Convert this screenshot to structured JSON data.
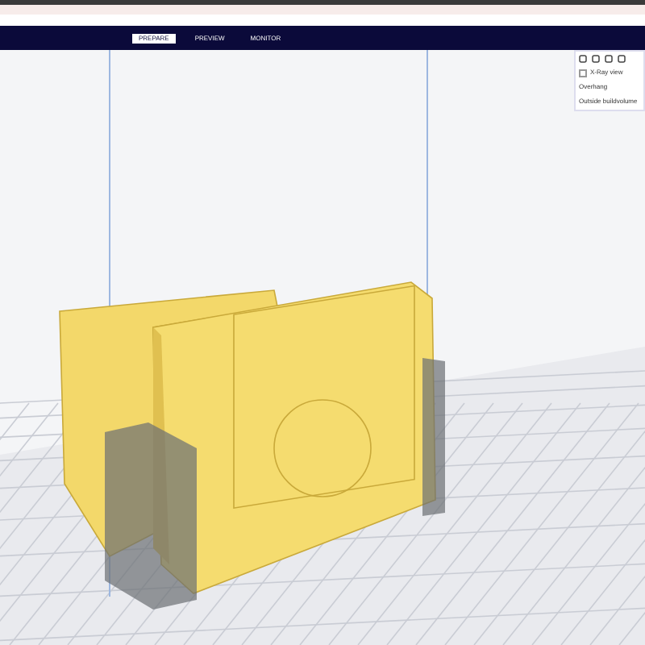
{
  "tabs": [
    {
      "label": "PREPARE",
      "selected": true
    },
    {
      "label": "PREVIEW",
      "selected": false
    },
    {
      "label": "MONITOR",
      "selected": false
    }
  ],
  "view_panel": {
    "xray": {
      "label": "X-Ray view",
      "checked": false
    },
    "legend": [
      "Overhang",
      "Outside buildvolume"
    ]
  }
}
